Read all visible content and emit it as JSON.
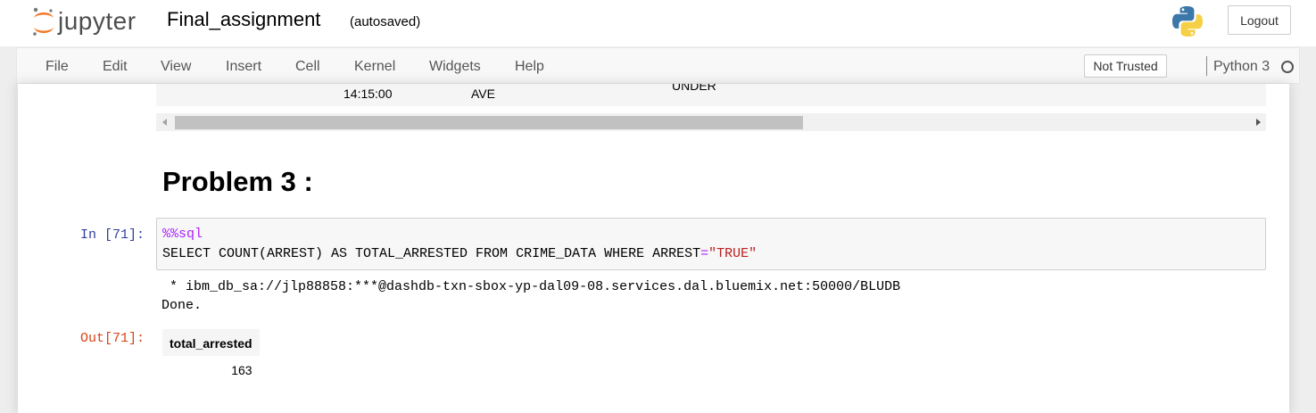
{
  "header": {
    "logo_text": "jupyter",
    "notebook_title": "Final_assignment",
    "autosave_status": "(autosaved)",
    "logout_label": "Logout",
    "python_logo_icon": "python-logo-icon"
  },
  "menubar": {
    "items": [
      "File",
      "Edit",
      "View",
      "Insert",
      "Cell",
      "Kernel",
      "Widgets",
      "Help"
    ],
    "trust_label": "Not Trusted",
    "kernel_name": "Python 3"
  },
  "prev_output_tail": {
    "col1": "14:15:00",
    "col2": "AVE",
    "col3": "UNDER"
  },
  "markdown_cell": {
    "heading": "Problem 3 :"
  },
  "code_cell": {
    "prompt": "In [71]:",
    "magic": "%%sql",
    "line2_prefix": "SELECT COUNT(ARREST) AS TOTAL_ARRESTED FROM CRIME_DATA WHERE ARREST",
    "line2_op": "=",
    "line2_string": "\"TRUE\"",
    "stdout_line1": " * ibm_db_sa://jlp88858:***@dashdb-txn-sbox-yp-dal09-08.services.dal.bluemix.net:50000/BLUDB",
    "stdout_line2": "Done.",
    "out_prompt": "Out[71]:",
    "result_table": {
      "columns": [
        "total_arrested"
      ],
      "rows": [
        [
          "163"
        ]
      ]
    }
  }
}
